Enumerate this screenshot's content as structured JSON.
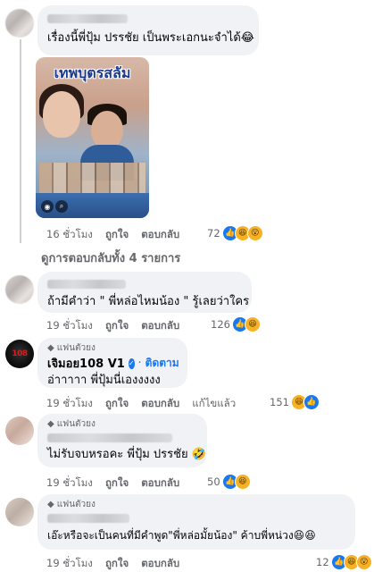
{
  "comments": [
    {
      "text": "เรื่องนี้พี่ปุ้ม ปรรชัย เป็นพระเอกนะจำได้😂",
      "poster_title": "เทพบุตรสลัม",
      "time": "16 ชั่วโมง",
      "like": "ถูกใจ",
      "reply": "ตอบกลับ",
      "reaction_count": "72",
      "reactions": [
        "like-icon",
        "haha-icon",
        "wow-icon"
      ]
    },
    {
      "text": "ถ้ามีคำว่า \" พี่หล่อไหมน้อง \" รู้เลยว่าใคร",
      "time": "19 ชั่วโมง",
      "like": "ถูกใจ",
      "reply": "ตอบกลับ",
      "reaction_count": "126",
      "reactions": [
        "like-icon",
        "haha-icon"
      ]
    },
    {
      "badge": "แฟนตัวยง",
      "name": "เจิมอย108 V1",
      "follow": "ติดตาม",
      "text": "อ่าาาาา พี่ปุ้มนี่เองงงงง",
      "time": "19 ชั่วโมง",
      "like": "ถูกใจ",
      "reply": "ตอบกลับ",
      "edited": "แก้ไขแล้ว",
      "reaction_count": "151",
      "reactions": [
        "haha-icon",
        "like-icon"
      ]
    },
    {
      "badge": "แฟนตัวยง",
      "text": "ไม่รับจบหรอคะ พี่ปุ้ม ปรรชัย 🤣",
      "time": "19 ชั่วโมง",
      "like": "ถูกใจ",
      "reply": "ตอบกลับ",
      "reaction_count": "50",
      "reactions": [
        "like-icon",
        "haha-icon"
      ]
    },
    {
      "badge": "แฟนตัวยง",
      "text": "เอ๊ะหรือจะเป็นคนที่มีคำพูด\"พี่หล่อมั้ยน้อง\" ค้าบพี่หน่วง😆😆",
      "time": "19 ชั่วโมง",
      "like": "ถูกใจ",
      "reply": "ตอบกลับ",
      "reaction_count": "12",
      "reactions": [
        "like-icon",
        "haha-icon",
        "wow-icon"
      ]
    }
  ],
  "view_replies": "ดูการตอบกลับทั้ง 4 รายการ",
  "colors": {
    "accent": "#1877f2",
    "bubble": "#f0f2f5",
    "meta": "#65676b"
  }
}
